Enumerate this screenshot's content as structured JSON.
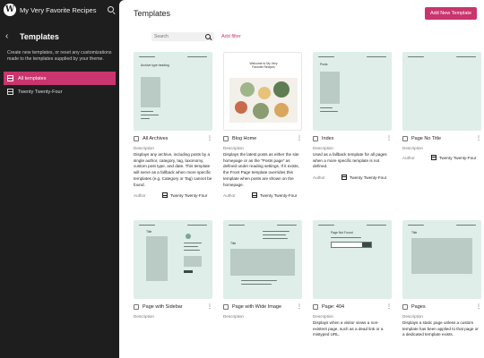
{
  "site": {
    "title": "My Very Favorite Recipes",
    "logo": "wordpress-logo"
  },
  "sidebar": {
    "title": "Templates",
    "description": "Create new templates, or reset any customizations made to the templates supplied by your theme.",
    "items": [
      {
        "label": "All templates",
        "icon": "template-icon",
        "active": true
      },
      {
        "label": "Twenty Twenty-Four",
        "icon": "template-icon",
        "active": false
      }
    ]
  },
  "main": {
    "title": "Templates",
    "add_button": "Add New Template",
    "search_placeholder": "Search",
    "add_filter": "Add filter"
  },
  "labels": {
    "description": "Description",
    "author": "Author"
  },
  "thumbs": {
    "archives_title": "Archive type heading",
    "blog_title": "Welcome to My Very Favorite Recipes",
    "index_title": "Posts",
    "sidebar_title": "Title",
    "wide_title": "Title",
    "notfound_title": "Page Not Found",
    "pages_title": "Title"
  },
  "templates": [
    {
      "name": "All Archives",
      "description": "Displays any archive, including posts by a single author, category, tag, taxonomy, custom post type, and date. This template will serve as a fallback when more specific templates (e.g. Category or Tag) cannot be found.",
      "author": "Twenty Twenty-Four"
    },
    {
      "name": "Blog Home",
      "description": "Displays the latest posts as either the site homepage or as the \"Posts page\" as defined under reading settings. If it exists, the Front Page template overrides this template when posts are shown on the homepage.",
      "author": "Twenty Twenty-Four"
    },
    {
      "name": "Index",
      "description": "Used as a fallback template for all pages when a more specific template is not defined.",
      "author": "Twenty Twenty-Four"
    },
    {
      "name": "Page No Title",
      "description": "",
      "author": "Twenty Twenty-Four"
    },
    {
      "name": "Page with Sidebar",
      "description": "",
      "author": ""
    },
    {
      "name": "Page with Wide Image",
      "description": "",
      "author": ""
    },
    {
      "name": "Page: 404",
      "description": "Displays when a visitor views a non-existent page, such as a dead link or a mistyped URL.",
      "author": ""
    },
    {
      "name": "Pages",
      "description": "Displays a static page unless a custom template has been applied to that page or a dedicated template exists.",
      "author": ""
    }
  ],
  "colors": {
    "accent": "#c9356e",
    "thumb_bg": "#dfeee8",
    "sidebar_bg": "#1e1e1e"
  }
}
